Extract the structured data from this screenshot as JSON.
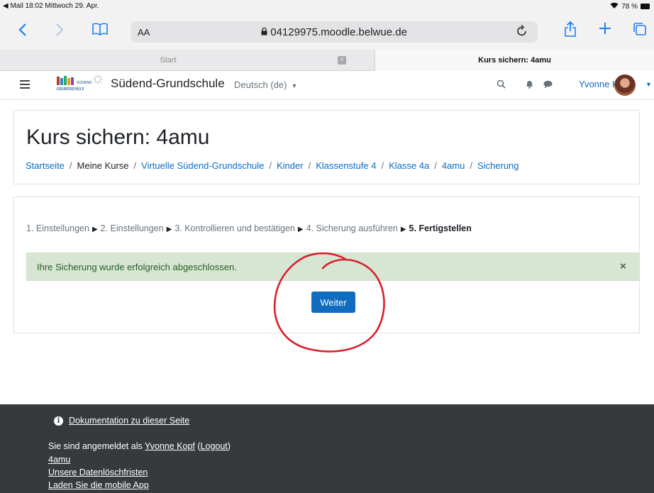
{
  "status_bar": {
    "back_app": "◀ Mail",
    "time": "18:02",
    "date": "Mittwoch 29. Apr.",
    "battery": "78 %"
  },
  "browser": {
    "reader_label": "AA",
    "url": "04129975.moodle.belwue.de",
    "tabs": [
      {
        "label": "Start"
      },
      {
        "label": "Kurs sichern: 4amu"
      }
    ],
    "accent": "#1f7ef5"
  },
  "navbar": {
    "site_name": "Südend-Grundschule",
    "language": "Deutsch (de)",
    "user_name": "Yvonne Kopf"
  },
  "header": {
    "title": "Kurs sichern: 4amu",
    "breadcrumb": [
      "Startseite",
      "Meine Kurse",
      "Virtuelle Südend-Grundschule",
      "Kinder",
      "Klassenstufe 4",
      "Klasse 4a",
      "4amu",
      "Sicherung"
    ]
  },
  "main": {
    "steps": [
      "1. Einstellungen",
      "2. Einstellungen",
      "3. Kontrollieren und bestätigen",
      "4. Sicherung ausführen",
      "5. Fertigstellen"
    ],
    "alert": {
      "message": "Ihre Sicherung wurde erfolgreich abgeschlossen.",
      "close": "×"
    },
    "continue_button": "Weiter"
  },
  "footer": {
    "doc_link": "Dokumentation zu dieser Seite",
    "logged_in_prefix": "Sie sind angemeldet als",
    "user_link": "Yvonne Kopf",
    "logout_link": "Logout",
    "course_link": "4amu",
    "retention_link": "Unsere Datenlöschfristen",
    "app_link": "Laden Sie die mobile App"
  },
  "colors": {
    "moodle_blue": "#0f6cbf",
    "success_bg": "#d7e6d3",
    "footer_bg": "#373a3c",
    "annotation": "#d9202a"
  }
}
